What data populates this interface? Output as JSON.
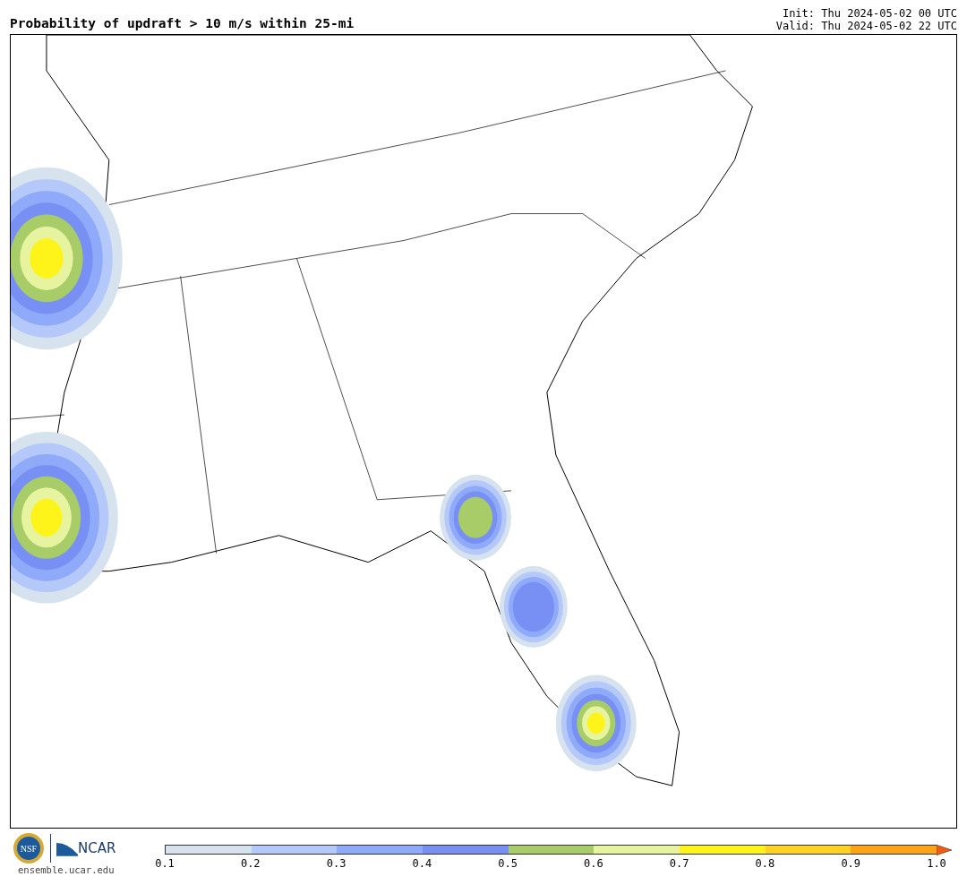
{
  "title": "Probability of updraft > 10 m/s within 25-mi",
  "init": "Init: Thu 2024-05-02 00 UTC",
  "valid": "Valid: Thu 2024-05-02 22 UTC",
  "logos": {
    "nsf": "NSF",
    "ncar": "NCAR",
    "site": "ensemble.ucar.edu"
  },
  "colorbar": {
    "bins": [
      {
        "color": "#d6e2ee"
      },
      {
        "color": "#b4c8fa"
      },
      {
        "color": "#8eaaf8"
      },
      {
        "color": "#7890f4"
      },
      {
        "color": "#a8cc68"
      },
      {
        "color": "#e6f4a0"
      },
      {
        "color": "#fef41a"
      },
      {
        "color": "#fed224"
      },
      {
        "color": "#fca414"
      }
    ],
    "extension": {
      "color": "#f05c10"
    },
    "ticks": [
      "0.1",
      "0.2",
      "0.3",
      "0.4",
      "0.5",
      "0.6",
      "0.7",
      "0.8",
      "0.9",
      "1.0"
    ]
  }
}
